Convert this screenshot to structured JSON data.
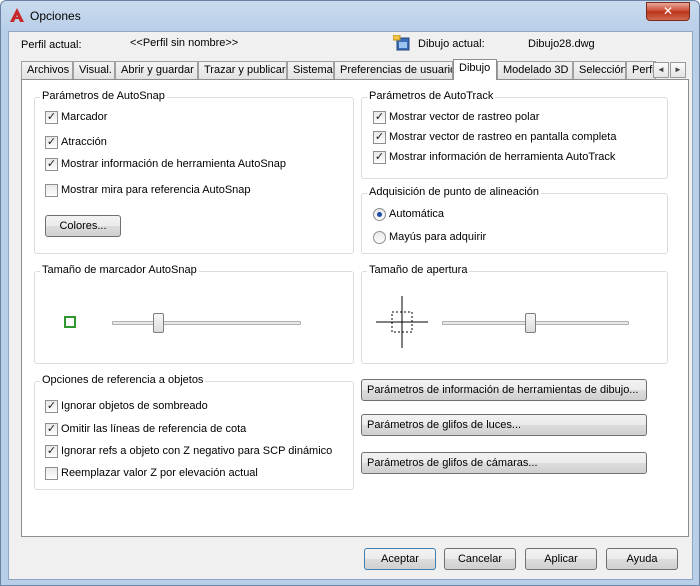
{
  "window": {
    "title": "Opciones",
    "close": "✕",
    "accent": "#c7442b"
  },
  "profile": {
    "label": "Perfil actual:",
    "value": "<<Perfil sin nombre>>",
    "drawing_label": "Dibujo actual:",
    "drawing_value": "Dibujo28.dwg"
  },
  "tabs": [
    {
      "label": "Archivos",
      "active": false
    },
    {
      "label": "Visual.",
      "active": false
    },
    {
      "label": "Abrir y guardar",
      "active": false
    },
    {
      "label": "Trazar y publicar",
      "active": false
    },
    {
      "label": "Sistema",
      "active": false
    },
    {
      "label": "Preferencias de usuario",
      "active": false
    },
    {
      "label": "Dibujo",
      "active": true
    },
    {
      "label": "Modelado 3D",
      "active": false
    },
    {
      "label": "Selección",
      "active": false
    },
    {
      "label": "Perfiles",
      "active": false
    }
  ],
  "tab_scroll": {
    "left": "◄",
    "right": "►"
  },
  "autosnap": {
    "title": "Parámetros de AutoSnap",
    "options": [
      {
        "label": "Marcador",
        "checked": true
      },
      {
        "label": "Atracción",
        "checked": true
      },
      {
        "label": "Mostrar información de herramienta AutoSnap",
        "checked": true
      },
      {
        "label": "Mostrar mira para referencia AutoSnap",
        "checked": false
      }
    ],
    "colors_button": "Colores..."
  },
  "autotrack": {
    "title": "Parámetros de AutoTrack",
    "options": [
      {
        "label": "Mostrar vector de rastreo polar",
        "checked": true
      },
      {
        "label": "Mostrar vector de rastreo en pantalla completa",
        "checked": true
      },
      {
        "label": "Mostrar información de herramienta AutoTrack",
        "checked": true
      }
    ]
  },
  "alignment": {
    "title": "Adquisición de punto de alineación",
    "options": [
      {
        "label": "Automática",
        "selected": true
      },
      {
        "label": "Mayús para adquirir",
        "selected": false
      }
    ]
  },
  "marker_size": {
    "title": "Tamaño de marcador AutoSnap",
    "level": 0.23,
    "preview_color": "#2e9a2e"
  },
  "aperture_size": {
    "title": "Tamaño de apertura",
    "level": 0.47
  },
  "osnap": {
    "title": "Opciones de referencia a objetos",
    "options": [
      {
        "label": "Ignorar objetos de sombreado",
        "checked": true
      },
      {
        "label": "Omitir las líneas de referencia de cota",
        "checked": true
      },
      {
        "label": "Ignorar refs a objeto con Z negativo para SCP dinámico",
        "checked": true
      },
      {
        "label": "Reemplazar valor Z por elevación actual",
        "checked": false
      }
    ]
  },
  "side_buttons": [
    "Parámetros de información de herramientas de dibujo...",
    "Parámetros de glifos de luces...",
    "Parámetros de glifos de cámaras..."
  ],
  "footer": {
    "accept": "Aceptar",
    "cancel": "Cancelar",
    "apply": "Aplicar",
    "help": "Ayuda"
  },
  "checkmark": "✓"
}
